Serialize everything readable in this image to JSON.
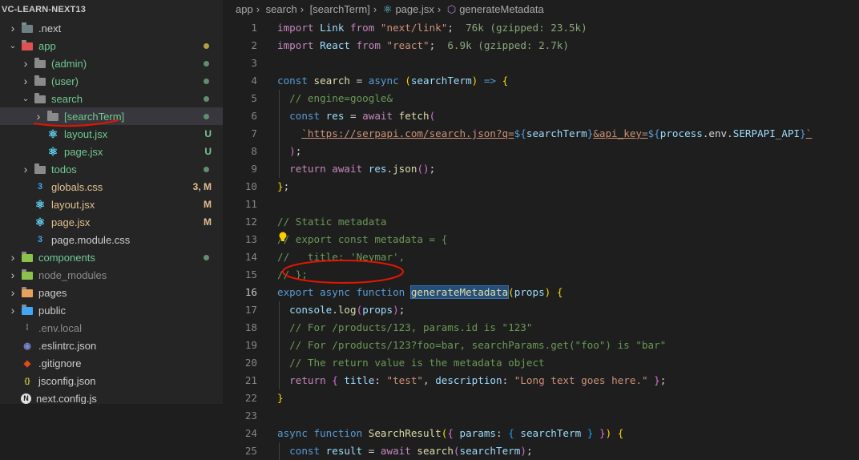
{
  "sidebar": {
    "title": "VC-LEARN-NEXT13",
    "items": [
      {
        "label": ".next",
        "status": ""
      },
      {
        "label": "app",
        "status": ""
      },
      {
        "label": "(admin)",
        "status": ""
      },
      {
        "label": "(user)",
        "status": ""
      },
      {
        "label": "search",
        "status": ""
      },
      {
        "label": "[searchTerm]",
        "status": ""
      },
      {
        "label": "layout.jsx",
        "status": "U"
      },
      {
        "label": "page.jsx",
        "status": "U"
      },
      {
        "label": "todos",
        "status": ""
      },
      {
        "label": "globals.css",
        "status": "3, M"
      },
      {
        "label": "layout.jsx",
        "status": "M"
      },
      {
        "label": "page.jsx",
        "status": "M"
      },
      {
        "label": "page.module.css",
        "status": ""
      },
      {
        "label": "components",
        "status": ""
      },
      {
        "label": "node_modules",
        "status": ""
      },
      {
        "label": "pages",
        "status": ""
      },
      {
        "label": "public",
        "status": ""
      },
      {
        "label": ".env.local",
        "status": ""
      },
      {
        "label": ".eslintrc.json",
        "status": ""
      },
      {
        "label": ".gitignore",
        "status": ""
      },
      {
        "label": "jsconfig.json",
        "status": ""
      },
      {
        "label": "next.config.js",
        "status": ""
      }
    ]
  },
  "breadcrumb": [
    "app",
    "search",
    "[searchTerm]",
    "page.jsx",
    "generateMetadata"
  ],
  "icons": {
    "react": "react-icon",
    "css": "css-icon",
    "folder": "folder-icon",
    "chevron": "chevron-icon",
    "lightbulb": "lightbulb-icon"
  },
  "colors": {
    "untracked": "#73c991",
    "modified": "#e2c08d",
    "selection": "#264f78",
    "annotation": "#e51400"
  },
  "code": {
    "line_numbers": [
      "1",
      "2",
      "3",
      "4",
      "5",
      "6",
      "7",
      "8",
      "9",
      "10",
      "11",
      "12",
      "13",
      "14",
      "15",
      "16",
      "17",
      "18",
      "19",
      "20",
      "21",
      "22",
      "23",
      "24",
      "25"
    ],
    "current_line": "16",
    "lines": [
      [
        [
          "kc",
          "import "
        ],
        [
          "var",
          "Link "
        ],
        [
          "kc",
          "from "
        ],
        [
          "str",
          "\"next/link\""
        ],
        [
          "",
          "; "
        ],
        [
          "sz",
          " 76k (gzipped: 23.5k)"
        ]
      ],
      [
        [
          "kc",
          "import "
        ],
        [
          "var",
          "React "
        ],
        [
          "kc",
          "from "
        ],
        [
          "str",
          "\"react\""
        ],
        [
          "",
          "; "
        ],
        [
          "sz",
          " 6.9k (gzipped: 2.7k)"
        ]
      ],
      [],
      [
        [
          "kw",
          "const "
        ],
        [
          "fn",
          "search"
        ],
        [
          "",
          " = "
        ],
        [
          "kw",
          "async "
        ],
        [
          "p1",
          "("
        ],
        [
          "var",
          "searchTerm"
        ],
        [
          "p1",
          ")"
        ],
        [
          "",
          " "
        ],
        [
          "kw",
          "=>"
        ],
        [
          "",
          " "
        ],
        [
          "p1",
          "{"
        ]
      ],
      [
        [
          "",
          ""
        ],
        [
          "cm",
          "  // engine=google&"
        ]
      ],
      [
        [
          "",
          "  "
        ],
        [
          "kw",
          "const "
        ],
        [
          "var",
          "res"
        ],
        [
          "",
          " = "
        ],
        [
          "kc",
          "await "
        ],
        [
          "fn",
          "fetch"
        ],
        [
          "p2",
          "("
        ]
      ],
      [
        [
          "",
          "    "
        ],
        [
          "str",
          "`https://serpapi.com/search.json?q="
        ],
        [
          "kw",
          "${"
        ],
        [
          "var",
          "searchTerm"
        ],
        [
          "kw",
          "}"
        ],
        [
          "str",
          "&api_key="
        ],
        [
          "kw",
          "${"
        ],
        [
          "var",
          "process"
        ],
        [
          "",
          ".env."
        ],
        [
          "var",
          "SERPAPI_API"
        ],
        [
          "kw",
          "}"
        ],
        [
          "str",
          "`"
        ]
      ],
      [
        [
          "",
          "  "
        ],
        [
          "p2",
          ")"
        ],
        [
          ";",
          ""
        ],
        [
          "",
          ";"
        ]
      ],
      [
        [
          "",
          "  "
        ],
        [
          "kc",
          "return "
        ],
        [
          "kc",
          "await "
        ],
        [
          "var",
          "res"
        ],
        [
          "",
          "."
        ],
        [
          "fn",
          "json"
        ],
        [
          "p2",
          "()"
        ],
        [
          "",
          ";"
        ]
      ],
      [
        [
          "p1",
          "}"
        ],
        [
          "",
          ";"
        ]
      ],
      [],
      [
        [
          "cm",
          "// Static metadata"
        ]
      ],
      [
        [
          "cm",
          "// export const metadata = {"
        ]
      ],
      [
        [
          "cm",
          "//   title: 'Neymar',"
        ]
      ],
      [
        [
          "cm",
          "// };"
        ]
      ],
      [
        [
          "kw",
          "export "
        ],
        [
          "kw",
          "async "
        ],
        [
          "kw",
          "function "
        ],
        [
          "fnhl",
          "generateMetadata"
        ],
        [
          "p1",
          "("
        ],
        [
          "var",
          "props"
        ],
        [
          "p1",
          ")"
        ],
        [
          "",
          " "
        ],
        [
          "p1",
          "{"
        ]
      ],
      [
        [
          "",
          "  "
        ],
        [
          "var",
          "console"
        ],
        [
          "",
          "."
        ],
        [
          "fn",
          "log"
        ],
        [
          "p2",
          "("
        ],
        [
          "var",
          "props"
        ],
        [
          "p2",
          ")"
        ],
        [
          "",
          ";"
        ]
      ],
      [
        [
          "cm",
          "  // For /products/123, params.id is \"123\""
        ]
      ],
      [
        [
          "cm",
          "  // For /products/123?foo=bar, searchParams.get(\"foo\") is \"bar\""
        ]
      ],
      [
        [
          "cm",
          "  // The return value is the metadata object"
        ]
      ],
      [
        [
          "",
          "  "
        ],
        [
          "kc",
          "return "
        ],
        [
          "p2",
          "{ "
        ],
        [
          "var",
          "title"
        ],
        [
          "",
          ": "
        ],
        [
          "str",
          "\"test\""
        ],
        [
          "",
          ", "
        ],
        [
          "var",
          "description"
        ],
        [
          "",
          ": "
        ],
        [
          "str",
          "\"Long text goes here.\""
        ],
        [
          "",
          " "
        ],
        [
          "p2",
          "}"
        ],
        [
          "",
          ";"
        ]
      ],
      [
        [
          "p1",
          "}"
        ]
      ],
      [],
      [
        [
          "kw",
          "async "
        ],
        [
          "kw",
          "function "
        ],
        [
          "fn",
          "SearchResult"
        ],
        [
          "p1",
          "("
        ],
        [
          "p2",
          "{ "
        ],
        [
          "var",
          "params"
        ],
        [
          "",
          ": "
        ],
        [
          "p3",
          "{ "
        ],
        [
          "var",
          "searchTerm"
        ],
        [
          "",
          " "
        ],
        [
          "p3",
          "}"
        ],
        [
          "",
          " "
        ],
        [
          "p2",
          "}"
        ],
        [
          "p1",
          ")"
        ],
        [
          "",
          " "
        ],
        [
          "p1",
          "{"
        ]
      ],
      [
        [
          "",
          "  "
        ],
        [
          "kw",
          "const "
        ],
        [
          "var",
          "result"
        ],
        [
          "",
          " = "
        ],
        [
          "kc",
          "await "
        ],
        [
          "fn",
          "search"
        ],
        [
          "p2",
          "("
        ],
        [
          "var",
          "searchTerm"
        ],
        [
          "p2",
          ")"
        ],
        [
          "",
          ";"
        ]
      ]
    ]
  }
}
